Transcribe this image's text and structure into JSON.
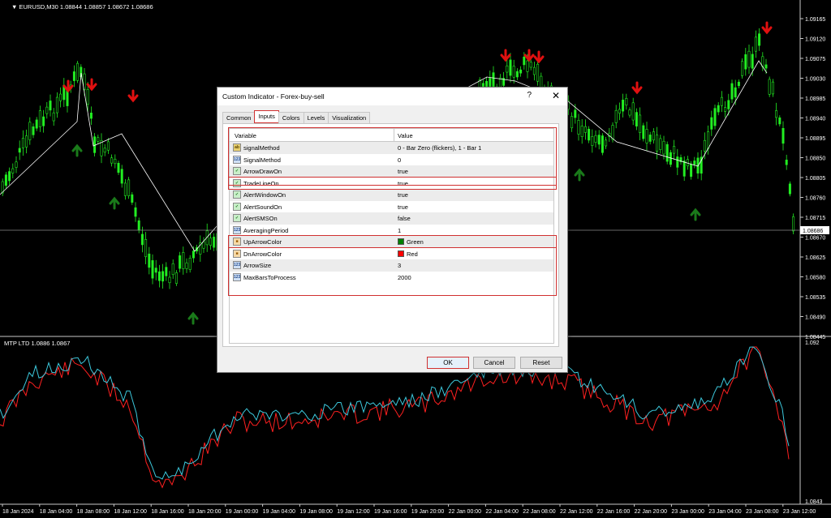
{
  "main_chart": {
    "header": "▼ EURUSD,M30  1.08844 1.08857 1.08672 1.08686",
    "price_labels": [
      "1.09165",
      "1.09120",
      "1.09075",
      "1.09030",
      "1.08985",
      "1.08940",
      "1.08895",
      "1.08850",
      "1.08805",
      "1.08760",
      "1.08715",
      "1.08670",
      "1.08625",
      "1.08580",
      "1.08535",
      "1.08490",
      "1.08445"
    ],
    "current_price": "1.08686",
    "colors": {
      "up_arrow": "#1a7a1a",
      "down_arrow": "#e01010",
      "candle": "#22ee22",
      "line": "#ffffff"
    }
  },
  "sub_chart": {
    "header": "MTP LTD 1.0886 1.0867",
    "top_label": "1.092",
    "bottom_label": "1.0843",
    "colors": {
      "series_a": "#ff2020",
      "series_b": "#3cc8dc"
    }
  },
  "time_axis": [
    "18 Jan 2024",
    "18 Jan 04:00",
    "18 Jan 08:00",
    "18 Jan 12:00",
    "18 Jan 16:00",
    "18 Jan 20:00",
    "19 Jan 00:00",
    "19 Jan 04:00",
    "19 Jan 08:00",
    "19 Jan 12:00",
    "19 Jan 16:00",
    "19 Jan 20:00",
    "22 Jan 00:00",
    "22 Jan 04:00",
    "22 Jan 08:00",
    "22 Jan 12:00",
    "22 Jan 16:00",
    "22 Jan 20:00",
    "23 Jan 00:00",
    "23 Jan 04:00",
    "23 Jan 08:00",
    "23 Jan 12:00"
  ],
  "dialog": {
    "title": "Custom Indicator - Forex-buy-sell",
    "help_label": "?",
    "close_label": "✕",
    "tabs": [
      "Common",
      "Inputs",
      "Colors",
      "Levels",
      "Visualization"
    ],
    "active_tab": "Inputs",
    "columns": {
      "variable": "Variable",
      "value": "Value"
    },
    "rows": [
      {
        "icon": "ab",
        "name": "signalMethod",
        "value": "0 - Bar Zero (flickers), 1 - Bar 1"
      },
      {
        "icon": "num",
        "name": "SignalMethod",
        "value": "0"
      },
      {
        "icon": "bool",
        "name": "ArrowDrawOn",
        "value": "true"
      },
      {
        "icon": "bool",
        "name": "TradeLineOn",
        "value": "true"
      },
      {
        "icon": "bool",
        "name": "AlertWindowOn",
        "value": "true"
      },
      {
        "icon": "bool",
        "name": "AlertSoundOn",
        "value": "true"
      },
      {
        "icon": "bool",
        "name": "AlertSMSOn",
        "value": "false"
      },
      {
        "icon": "num",
        "name": "AveragingPeriod",
        "value": "1"
      },
      {
        "icon": "clr",
        "name": "UpArrowColor",
        "value": "Green",
        "swatch": "#008000"
      },
      {
        "icon": "clr",
        "name": "DnArrowColor",
        "value": "Red",
        "swatch": "#ff0000"
      },
      {
        "icon": "num",
        "name": "ArrowSize",
        "value": "3"
      },
      {
        "icon": "num",
        "name": "MaxBarsToProcess",
        "value": "2000"
      }
    ],
    "buttons": {
      "ok": "OK",
      "cancel": "Cancel",
      "reset": "Reset"
    }
  }
}
